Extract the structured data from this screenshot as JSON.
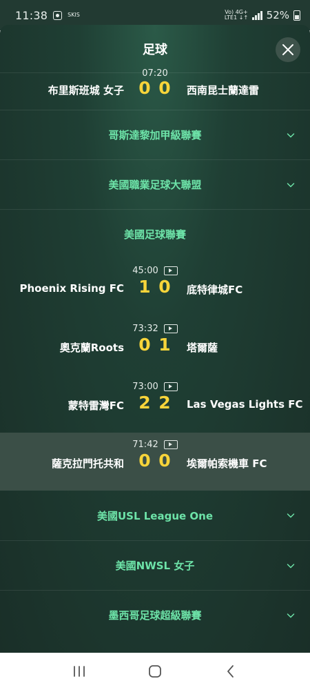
{
  "status_bar": {
    "time": "11:38",
    "app_label": "SKIS",
    "network_top": "Vo) 4G+",
    "network_bottom": "LTE1 ↓↑",
    "battery": "52%"
  },
  "sheet": {
    "title": "足球"
  },
  "top_match": {
    "time": "07:20",
    "home": "布里斯班城 女子",
    "home_score": "0",
    "away_score": "0",
    "away": "西南昆士蘭達雷"
  },
  "leagues_collapsed_top": [
    {
      "name": "哥斯達黎加甲級聯賽"
    },
    {
      "name": "美國職業足球大聯盟"
    }
  ],
  "expanded_league": {
    "name": "美國足球聯賽",
    "matches": [
      {
        "time": "45:00",
        "home": "Phoenix Rising FC",
        "home_score": "1",
        "away_score": "0",
        "away": "底特律城FC"
      },
      {
        "time": "73:32",
        "home": "奧克蘭Roots",
        "home_score": "0",
        "away_score": "1",
        "away": "塔爾薩"
      },
      {
        "time": "73:00",
        "home": "蒙特雷灣FC",
        "home_score": "2",
        "away_score": "2",
        "away": "Las Vegas Lights FC"
      },
      {
        "time": "71:42",
        "home": "薩克拉門托共和",
        "home_score": "0",
        "away_score": "0",
        "away": "埃爾帕索機車 FC"
      }
    ]
  },
  "leagues_collapsed_bottom": [
    {
      "name": "美國USL League One"
    },
    {
      "name": "美國NWSL 女子"
    },
    {
      "name": "墨西哥足球超級聯賽"
    }
  ],
  "colors": {
    "accent_green": "#6de3a8",
    "score_yellow": "#f7d43a",
    "sheet_bg": "#1f3f34"
  },
  "icons": [
    "close-icon",
    "chevron-down-icon",
    "video-icon",
    "recents-icon",
    "home-icon",
    "back-icon"
  ]
}
